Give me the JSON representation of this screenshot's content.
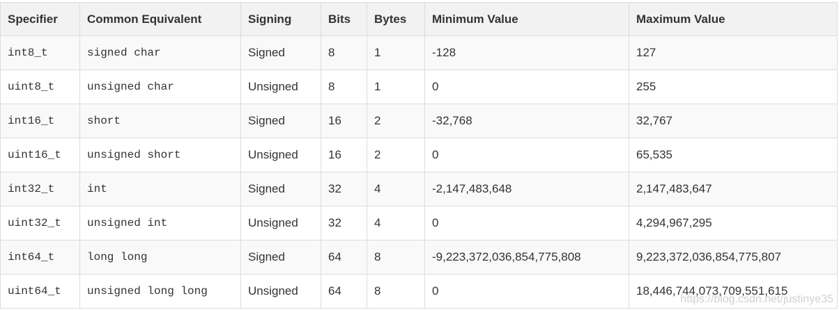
{
  "table": {
    "headers": [
      "Specifier",
      "Common Equivalent",
      "Signing",
      "Bits",
      "Bytes",
      "Minimum Value",
      "Maximum Value"
    ],
    "rows": [
      [
        "int8_t",
        "signed char",
        "Signed",
        "8",
        "1",
        "-128",
        "127"
      ],
      [
        "uint8_t",
        "unsigned char",
        "Unsigned",
        "8",
        "1",
        "0",
        "255"
      ],
      [
        "int16_t",
        "short",
        "Signed",
        "16",
        "2",
        "-32,768",
        "32,767"
      ],
      [
        "uint16_t",
        "unsigned short",
        "Unsigned",
        "16",
        "2",
        "0",
        "65,535"
      ],
      [
        "int32_t",
        "int",
        "Signed",
        "32",
        "4",
        "-2,147,483,648",
        "2,147,483,647"
      ],
      [
        "uint32_t",
        "unsigned int",
        "Unsigned",
        "32",
        "4",
        "0",
        "4,294,967,295"
      ],
      [
        "int64_t",
        "long long",
        "Signed",
        "64",
        "8",
        "-9,223,372,036,854,775,808",
        "9,223,372,036,854,775,807"
      ],
      [
        "uint64_t",
        "unsigned long long",
        "Unsigned",
        "64",
        "8",
        "0",
        "18,446,744,073,709,551,615"
      ]
    ]
  },
  "watermark": "https://blog.csdn.net/justinye35"
}
